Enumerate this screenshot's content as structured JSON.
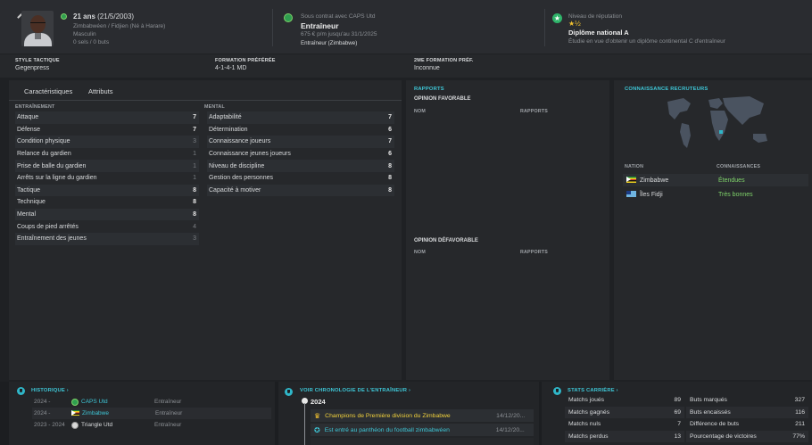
{
  "header": {
    "age": "21 ans",
    "birth": "(21/5/2003)",
    "nationality": "Zimbabwéen / Fidjien (Né à Harare)",
    "gender": "Masculin",
    "goals": "0 sels / 0 buts",
    "contract_label": "Sous contrat avec CAPS Utd",
    "role": "Entraîneur",
    "contract_detail": "675 € p/m jusqu'au 31/1/2025",
    "contract_role2": "Entraîneur (Zimbabwe)",
    "reputation_label": "Niveau de réputation",
    "reputation_stars": "★½",
    "diploma": "Diplôme national A",
    "diploma_detail": "Étudie en vue d'obtenir un diplôme continental C d'entraîneur"
  },
  "tactic": {
    "style_label": "STYLE TACTIQUE",
    "style_value": "Gegenpress",
    "formation_label": "FORMATION PRÉFÉRÉE",
    "formation_value": "4-1-4-1 MD",
    "formation2_label": "2ME FORMATION PRÉF.",
    "formation2_value": "Inconnue"
  },
  "tabs": [
    {
      "label": "Caractéristiques"
    },
    {
      "label": "Attributs"
    }
  ],
  "training": {
    "title": "ENTRAÎNEMENT",
    "rows": [
      {
        "name": "Attaque",
        "value": "7"
      },
      {
        "name": "Défense",
        "value": "7"
      },
      {
        "name": "Condition physique",
        "value": "3"
      },
      {
        "name": "Relance du gardien",
        "value": "1"
      },
      {
        "name": "Prise de balle du gardien",
        "value": "1"
      },
      {
        "name": "Arrêts sur la ligne du gardien",
        "value": "1"
      },
      {
        "name": "Tactique",
        "value": "8"
      },
      {
        "name": "Technique",
        "value": "8"
      },
      {
        "name": "Mental",
        "value": "8"
      },
      {
        "name": "Coups de pied arrêtés",
        "value": "4"
      },
      {
        "name": "Entraînement des jeunes",
        "value": "3"
      }
    ]
  },
  "mental": {
    "title": "MENTAL",
    "rows": [
      {
        "name": "Adaptabilité",
        "value": "7"
      },
      {
        "name": "Détermination",
        "value": "6"
      },
      {
        "name": "Connaissance joueurs",
        "value": "7"
      },
      {
        "name": "Connaissance jeunes joueurs",
        "value": "6"
      },
      {
        "name": "Niveau de discipline",
        "value": "8"
      },
      {
        "name": "Gestion des personnes",
        "value": "8"
      },
      {
        "name": "Capacité à motiver",
        "value": "8"
      }
    ]
  },
  "reports": {
    "title": "RAPPORTS",
    "favorable": "OPINION FAVORABLE",
    "unfavorable": "OPINION DÉFAVORABLE",
    "col_name": "NOM",
    "col_reports": "RAPPORTS"
  },
  "scouting": {
    "title": "CONNAISSANCE RECRUTEURS",
    "col_nation": "NATION",
    "col_knowledge": "CONNAISSANCES",
    "rows": [
      {
        "nation": "Zimbabwe",
        "knowledge": "Étendues"
      },
      {
        "nation": "Îles Fidji",
        "knowledge": "Très bonnes"
      }
    ]
  },
  "history": {
    "title": "HISTORIQUE",
    "rows": [
      {
        "years": "2024 -",
        "club": "CAPS Utd",
        "role": "Entraîneur"
      },
      {
        "years": "2024 -",
        "club": "Zimbabwe",
        "role": "Entraîneur"
      },
      {
        "years": "2023 - 2024",
        "club": "Triangle Utd",
        "role": "Entraîneur"
      }
    ]
  },
  "timeline": {
    "title": "VOIR CHRONOLOGIE DE L'ENTRAÎNEUR",
    "year": "2024",
    "items": [
      {
        "text": "Champions de Première division du Zimbabwe",
        "date": "14/12/20..."
      },
      {
        "text": "Est entré au panthéon du football zimbabwéen",
        "date": "14/12/20..."
      }
    ]
  },
  "stats": {
    "title": "STATS CARRIÈRE",
    "left": [
      {
        "label": "Matchs joués",
        "value": "89"
      },
      {
        "label": "Matchs gagnés",
        "value": "69"
      },
      {
        "label": "Matchs nuls",
        "value": "7"
      },
      {
        "label": "Matchs perdus",
        "value": "13"
      }
    ],
    "right": [
      {
        "label": "Buts marqués",
        "value": "327"
      },
      {
        "label": "Buts encaissés",
        "value": "116"
      },
      {
        "label": "Différence de buts",
        "value": "211"
      },
      {
        "label": "Pourcentage de victoires",
        "value": "77%"
      }
    ]
  }
}
